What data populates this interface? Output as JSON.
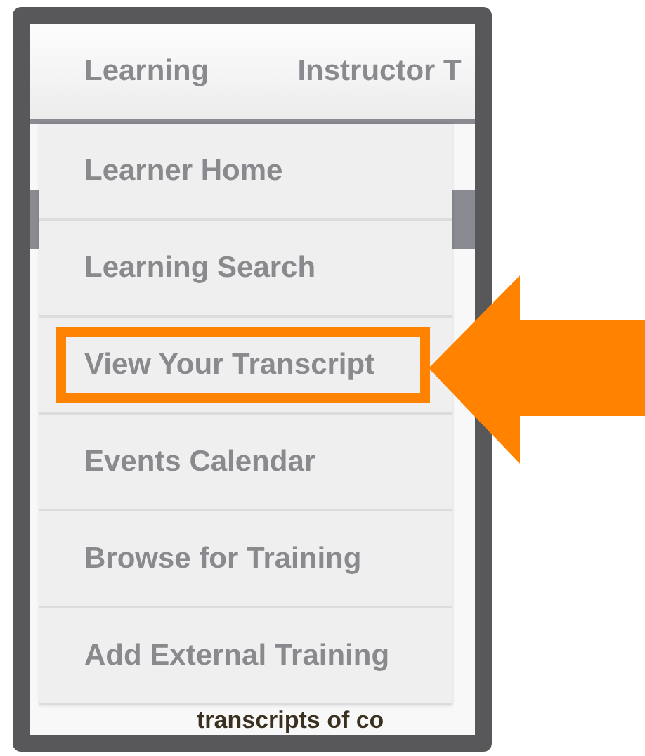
{
  "nav": {
    "tabs": [
      {
        "label": "Learning"
      },
      {
        "label": "Instructor T"
      }
    ]
  },
  "menu": {
    "items": [
      {
        "label": "Learner Home",
        "highlighted": false
      },
      {
        "label": "Learning Search",
        "highlighted": false
      },
      {
        "label": "View Your Transcript",
        "highlighted": true
      },
      {
        "label": "Events Calendar",
        "highlighted": false
      },
      {
        "label": "Browse for Training",
        "highlighted": false
      },
      {
        "label": "Add External Training",
        "highlighted": false
      }
    ]
  },
  "page_text": "transcripts of co"
}
